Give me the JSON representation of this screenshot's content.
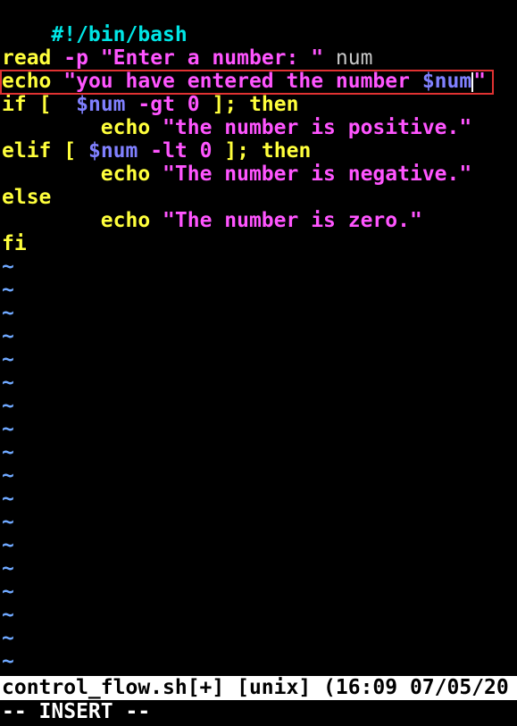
{
  "editor": {
    "lines": {
      "shebang": "#!/bin/bash",
      "read_kw": "read",
      "read_flag": "-p",
      "read_str": "\"Enter a number: \"",
      "read_var": "num",
      "echo1_kw": "echo",
      "echo1_str": "\"you have entered the number ",
      "echo1_var": "$num",
      "echo1_end": "\"",
      "if_kw": "if",
      "if_bracket": "[",
      "if_var": "$num",
      "if_op": "-gt",
      "if_num": "0",
      "if_close": "];",
      "if_then": "then",
      "echo2_kw": "echo",
      "echo2_str": "\"the number is positive.\"",
      "elif_kw": "elif",
      "elif_bracket": "[",
      "elif_var": "$num",
      "elif_op": "-lt",
      "elif_num": "0",
      "elif_close": "];",
      "elif_then": "then",
      "echo3_kw": "echo",
      "echo3_str": "\"The number is negative.\"",
      "else_kw": "else",
      "echo4_kw": "echo",
      "echo4_str": "\"The number is zero.\"",
      "fi_kw": "fi"
    },
    "tilde": "~"
  },
  "statusbar": {
    "text": "control_flow.sh[+] [unix] (16:09 07/05/20"
  },
  "modeline": {
    "text": "-- INSERT --"
  },
  "colors": {
    "keyword": "#ffff3c",
    "string": "#ff55ff",
    "variable": "#8080ff",
    "shebang": "#00e6e6",
    "tilde": "#6fa8ff",
    "highlight_box": "#e03232"
  }
}
